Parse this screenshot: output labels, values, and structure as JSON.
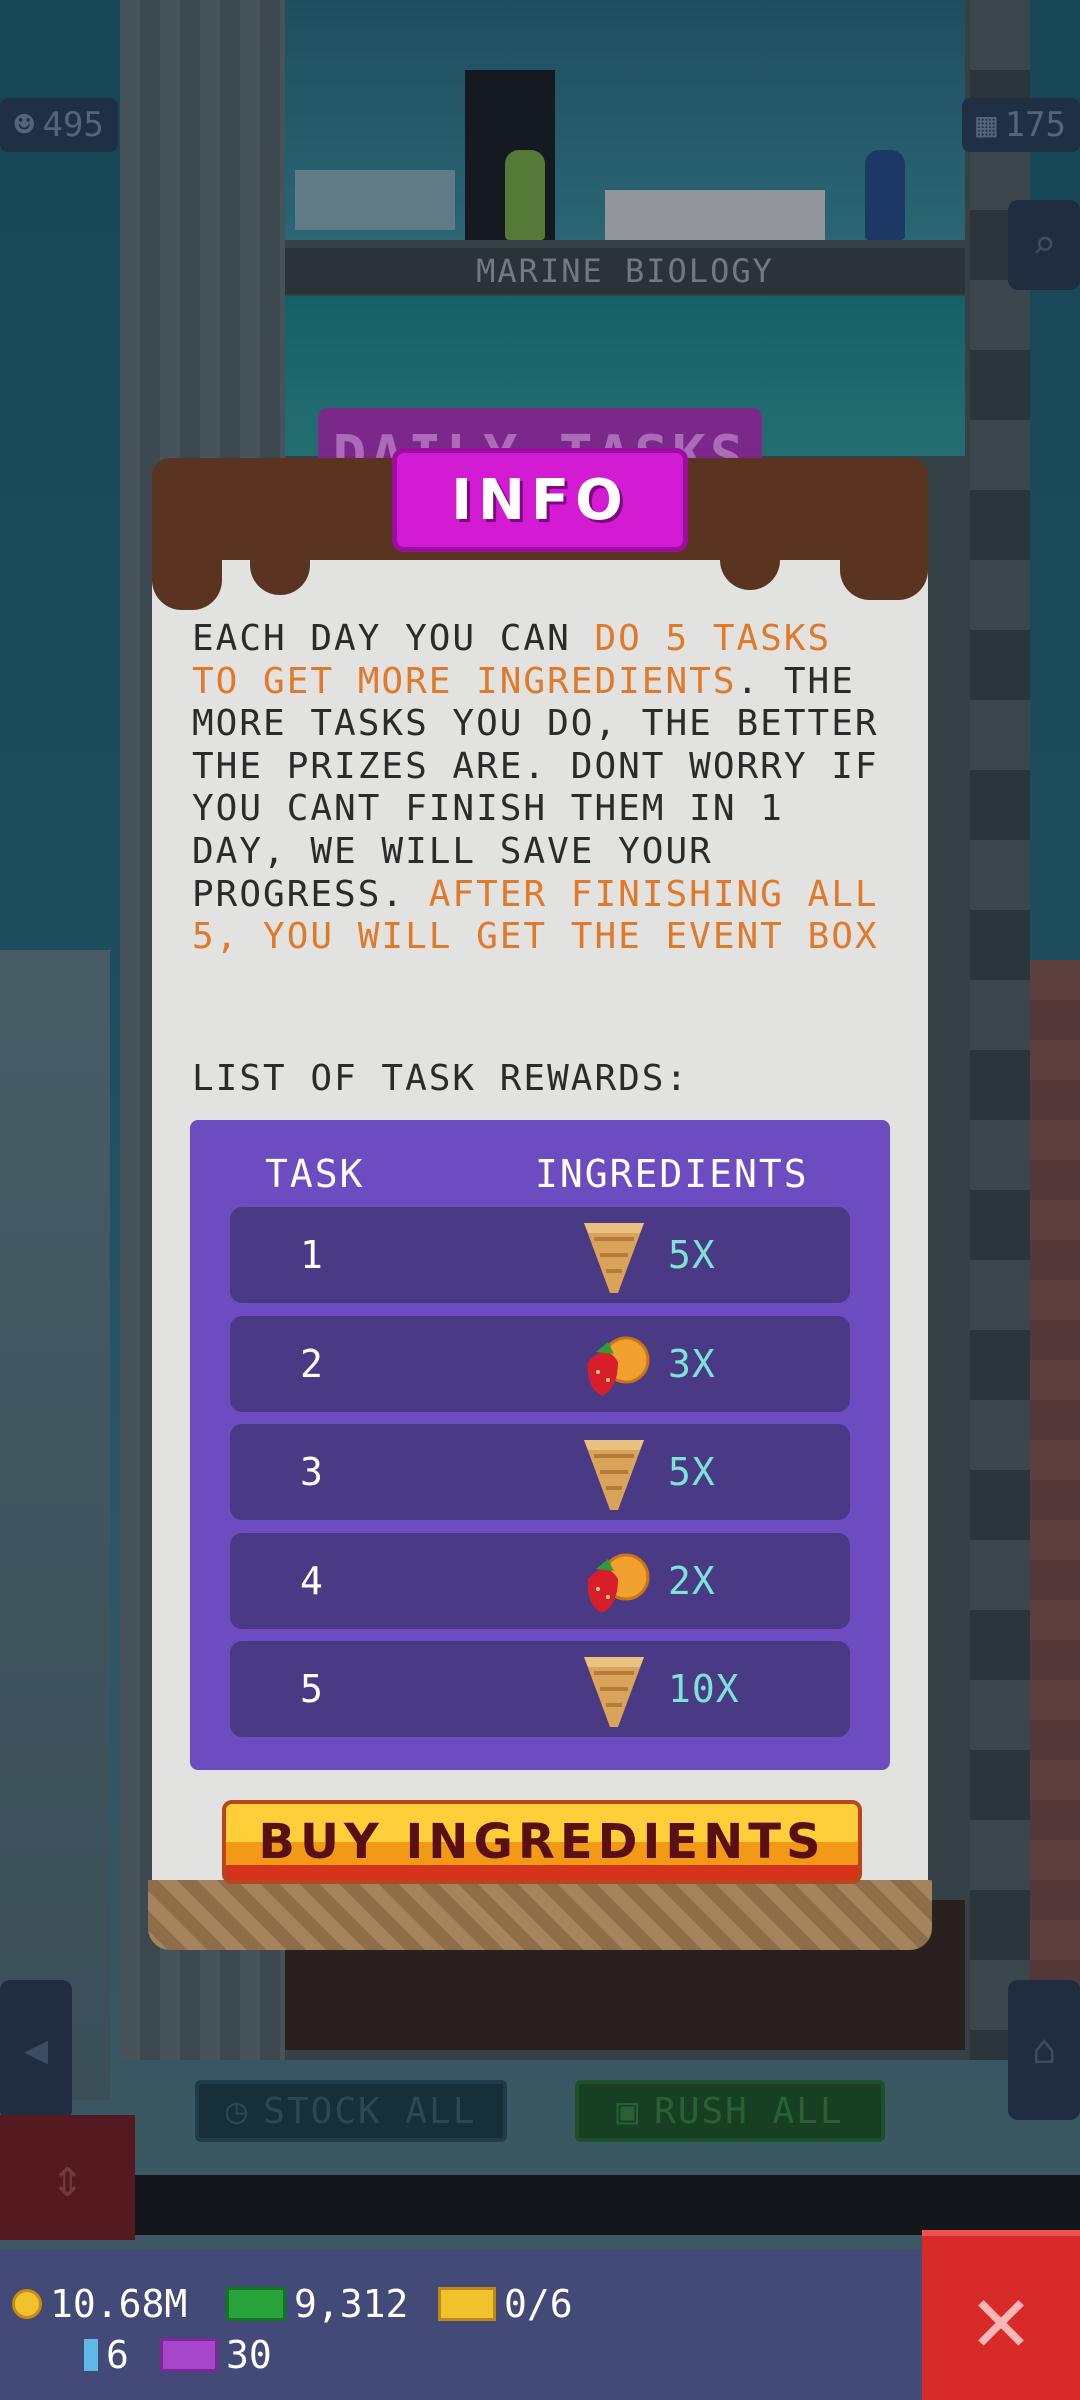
{
  "hud": {
    "population": "495",
    "floors": "175",
    "floor_label": "MARINE BIOLOGY",
    "ghost_banner": "DAILY TASKS",
    "stock_all": "STOCK ALL",
    "rush_all": "RUSH ALL"
  },
  "dialog": {
    "title": "INFO",
    "text_parts": [
      {
        "t": "EACH DAY YOU CAN ",
        "hl": false
      },
      {
        "t": "DO 5 TASKS TO GET MORE INGREDIENTS",
        "hl": true
      },
      {
        "t": ". THE MORE TASKS YOU DO, THE BETTER THE PRIZES ARE. DONT WORRY IF YOU CANT FINISH THEM IN 1 DAY, WE WILL SAVE YOUR PROGRESS. ",
        "hl": false
      },
      {
        "t": "AFTER FINISHING ALL 5, YOU WILL GET THE EVENT BOX",
        "hl": true
      }
    ],
    "rewards_heading": "LIST OF TASK REWARDS:",
    "table": {
      "col_task": "TASK",
      "col_ingredients": "INGREDIENTS",
      "rows": [
        {
          "task": "1",
          "icon": "cone-icon",
          "qty": "5X"
        },
        {
          "task": "2",
          "icon": "fruit-icon",
          "qty": "3X"
        },
        {
          "task": "3",
          "icon": "cone-icon",
          "qty": "5X"
        },
        {
          "task": "4",
          "icon": "fruit-icon",
          "qty": "2X"
        },
        {
          "task": "5",
          "icon": "cone-icon",
          "qty": "10X"
        }
      ]
    },
    "buy_button": "BUY INGREDIENTS"
  },
  "resources": {
    "coins": "10.68M",
    "bux": "9,312",
    "tickets": "0/6",
    "crystals": "6",
    "vip": "30"
  },
  "colors": {
    "highlight": "#e07a2a",
    "title_badge": "#d21bd3",
    "table_bg": "#6c4cc0",
    "row_bg": "#4a3a85",
    "qty_text": "#7ce3d6",
    "close_button": "#d92a2a"
  }
}
